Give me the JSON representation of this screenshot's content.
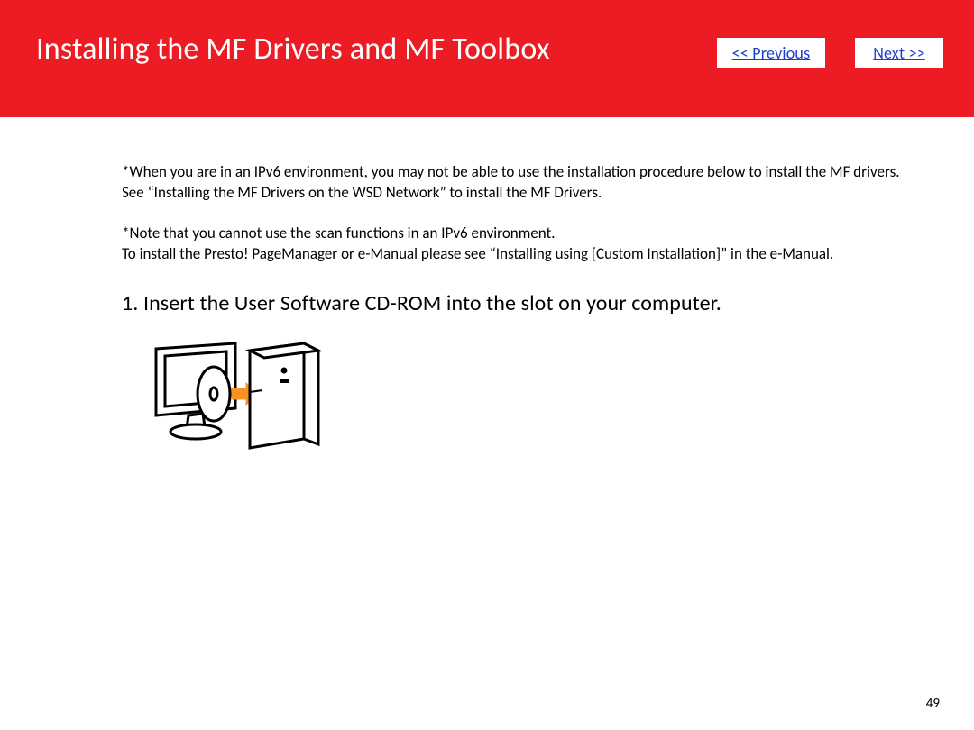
{
  "header": {
    "title": "Installing the MF Drivers and MF Toolbox",
    "prev_label": "<< Previous",
    "next_label": "Next >>"
  },
  "notes": {
    "p1": "*When you are in an IPv6 environment, you may not be able to use the installation procedure below to install the MF drivers.",
    "p2": "See “Installing the MF Drivers on the WSD Network” to install the MF Drivers.",
    "p3": "*Note that you cannot use the scan functions in an IPv6 environment.",
    "p4": "To install the Presto! PageManager or e-Manual please see “Installing using [Custom Installation]” in the e-Manual."
  },
  "step": {
    "heading": "1. Insert the User Software CD-ROM into the slot on your computer."
  },
  "page_number": "49"
}
